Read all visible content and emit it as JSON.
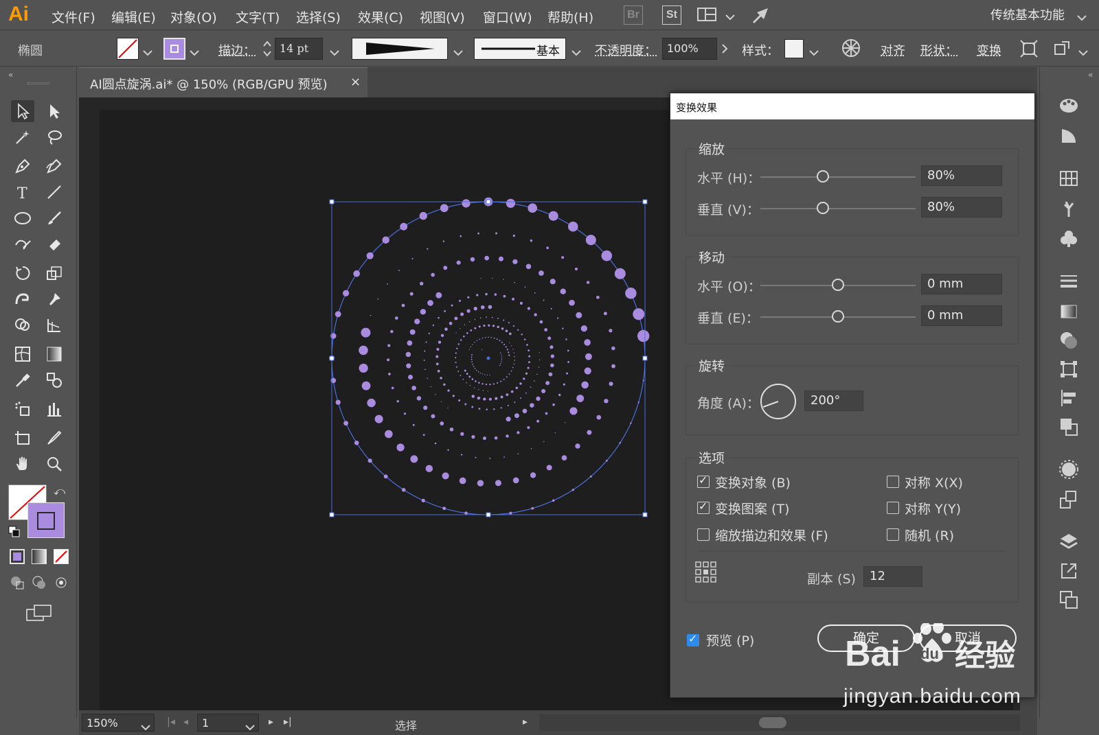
{
  "app": {
    "logo": "Ai",
    "menu": [
      "文件(F)",
      "编辑(E)",
      "对象(O)",
      "文字(T)",
      "选择(S)",
      "效果(C)",
      "视图(V)",
      "窗口(W)",
      "帮助(H)"
    ],
    "badges": [
      "Br",
      "St"
    ],
    "workspace": "传统基本功能"
  },
  "control": {
    "object_type": "椭圆",
    "stroke_label": "描边：",
    "stroke_value": "14 pt",
    "brush_label": "基本",
    "opacity_label": "不透明度：",
    "opacity_value": "100%",
    "style_label": "样式：",
    "align_label": "对齐",
    "shape_label": "形状：",
    "transform_label": "变换",
    "fill_color": "#a98be0"
  },
  "document": {
    "tab_title": "AI圆点旋涡.ai* @ 150% (RGB/GPU 预览)",
    "close": "×"
  },
  "status": {
    "zoom": "150%",
    "page": "1",
    "mode": "选择"
  },
  "dialog": {
    "title": "变换效果",
    "scale": {
      "title": "缩放",
      "h_label": "水平 (H)：",
      "h_value": "80%",
      "v_label": "垂直 (V)：",
      "v_value": "80%"
    },
    "move": {
      "title": "移动",
      "h_label": "水平 (O)：",
      "h_value": "0 mm",
      "v_label": "垂直 (E)：",
      "v_value": "0 mm"
    },
    "rotate": {
      "title": "旋转",
      "angle_label": "角度 (A)：",
      "angle_value": "200°"
    },
    "options": {
      "title": "选项",
      "transform_objects": "变换对象 (B)",
      "transform_patterns": "变换图案 (T)",
      "scale_strokes": "缩放描边和效果 (F)",
      "reflect_x": "对称 X(X)",
      "reflect_y": "对称 Y(Y)",
      "random": "随机 (R)",
      "copies_label": "副本 (S)",
      "copies_value": "12"
    },
    "preview": "预览 (P)",
    "ok": "确定",
    "cancel": "取消"
  },
  "watermark": {
    "site": "jingyan.baidu.com",
    "brand": "Bai",
    "brand_du": "du",
    "brand_cn": "经验"
  }
}
